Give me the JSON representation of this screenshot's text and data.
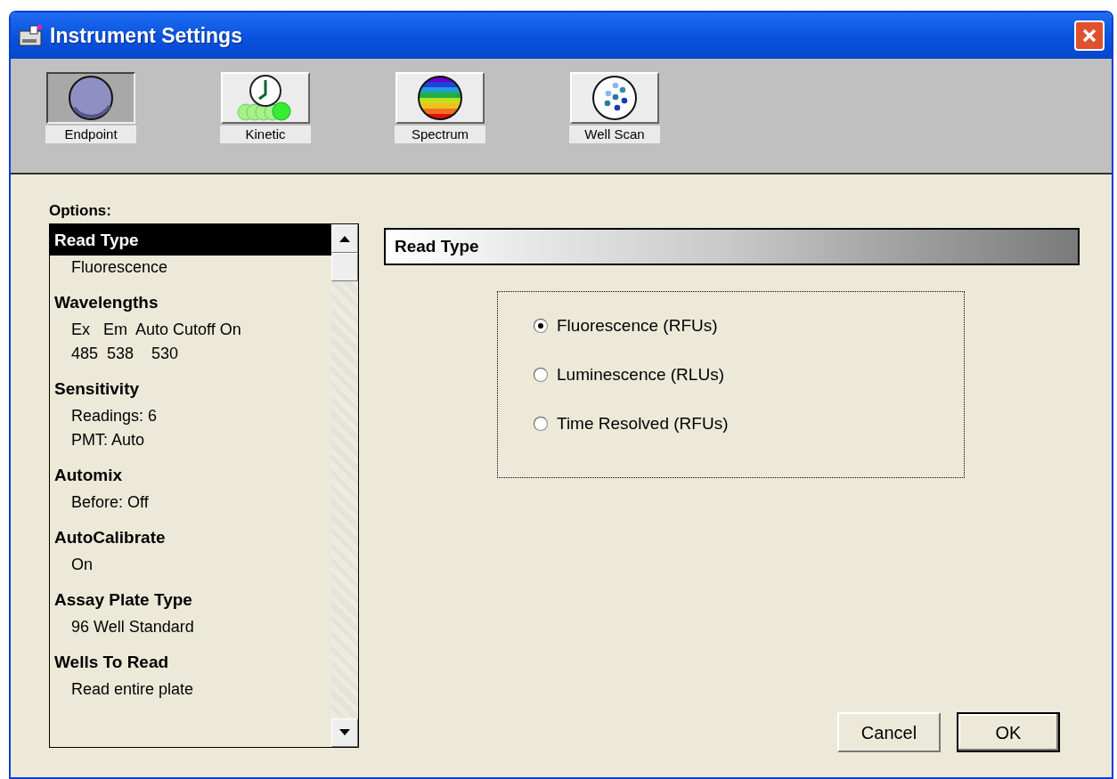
{
  "window": {
    "title": "Instrument Settings"
  },
  "modes": [
    {
      "label": "Endpoint",
      "kind": "endpoint",
      "selected": true
    },
    {
      "label": "Kinetic",
      "kind": "kinetic",
      "selected": false
    },
    {
      "label": "Spectrum",
      "kind": "spectrum",
      "selected": false
    },
    {
      "label": "Well Scan",
      "kind": "wellscan",
      "selected": false
    }
  ],
  "options": {
    "label": "Options:",
    "items": [
      {
        "heading": "Read Type",
        "selected": true,
        "values": [
          "Fluorescence"
        ]
      },
      {
        "heading": "Wavelengths",
        "selected": false,
        "values": [
          "Ex   Em  Auto Cutoff On",
          "485  538    530"
        ]
      },
      {
        "heading": "Sensitivity",
        "selected": false,
        "values": [
          "Readings: 6",
          "PMT: Auto"
        ]
      },
      {
        "heading": "Automix",
        "selected": false,
        "values": [
          "Before: Off"
        ]
      },
      {
        "heading": "AutoCalibrate",
        "selected": false,
        "values": [
          "On"
        ]
      },
      {
        "heading": "Assay Plate Type",
        "selected": false,
        "values": [
          "96 Well Standard"
        ]
      },
      {
        "heading": "Wells To Read",
        "selected": false,
        "values": [
          "Read entire plate"
        ]
      }
    ]
  },
  "panel": {
    "title": "Read Type",
    "choices": [
      {
        "label": "Fluorescence (RFUs)",
        "selected": true
      },
      {
        "label": "Luminescence (RLUs)",
        "selected": false
      },
      {
        "label": "Time Resolved (RFUs)",
        "selected": false
      }
    ]
  },
  "buttons": [
    {
      "label": "Cancel",
      "default": false
    },
    {
      "label": "OK",
      "default": true
    }
  ]
}
